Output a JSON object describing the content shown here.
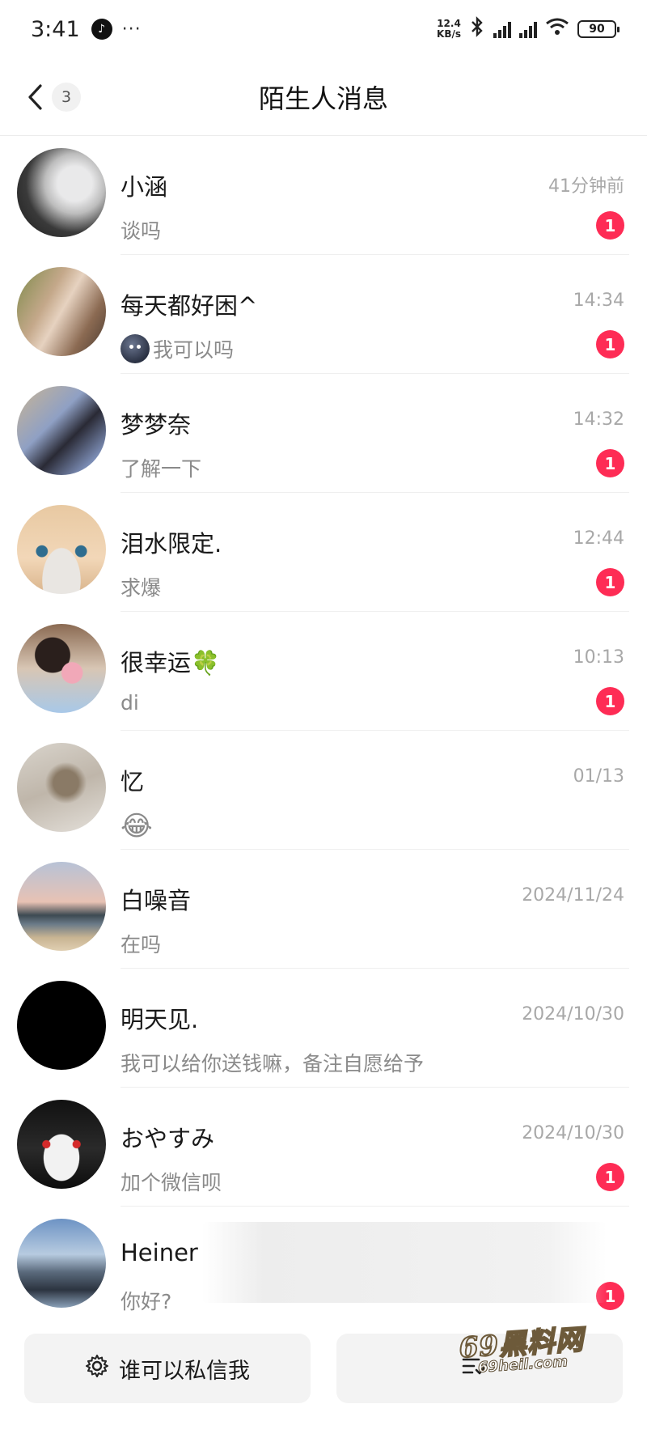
{
  "status_bar": {
    "time": "3:41",
    "dots": "···",
    "net_speed_value": "12.4",
    "net_speed_unit": "KB/s",
    "battery": "90"
  },
  "header": {
    "title": "陌生人消息",
    "back_count": "3"
  },
  "chats": [
    {
      "name": "小涵",
      "time": "41分钟前",
      "message": "谈吗",
      "unread": "1"
    },
    {
      "name": "每天都好困^",
      "time": "14:34",
      "message": "我可以吗",
      "unread": "1"
    },
    {
      "name": "梦梦奈",
      "time": "14:32",
      "message": "了解一下",
      "unread": "1"
    },
    {
      "name": "泪水限定.",
      "time": "12:44",
      "message": "求爆",
      "unread": "1"
    },
    {
      "name": "很幸运🍀",
      "time": "10:13",
      "message": "di",
      "unread": "1"
    },
    {
      "name": "忆",
      "time": "01/13",
      "message": "😂",
      "unread": ""
    },
    {
      "name": "白噪音",
      "time": "2024/11/24",
      "message": "在吗",
      "unread": ""
    },
    {
      "name": "明天见.",
      "time": "2024/10/30",
      "message": "我可以给你送钱嘛，备注自愿给予",
      "unread": ""
    },
    {
      "name": "おやすみ",
      "time": "2024/10/30",
      "message": "加个微信呗",
      "unread": "1"
    },
    {
      "name": "Heiner",
      "time": "",
      "message": "你好?",
      "unread": "1"
    }
  ],
  "footer": {
    "privacy_label": "谁可以私信我",
    "manage_label": ""
  },
  "watermark": {
    "main": "69黑料网",
    "sub": "69heil.com"
  },
  "colors": {
    "badge": "#fe2c55",
    "time": "#a8a8a8",
    "preview": "#8a8a8a"
  }
}
